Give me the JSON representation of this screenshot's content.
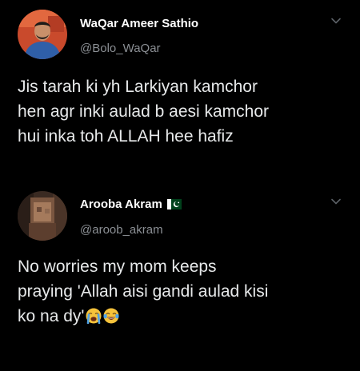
{
  "tweets": [
    {
      "display_name": "WaQar Ameer Sathio",
      "handle": "@Bolo_WaQar",
      "text": "Jis tarah ki yh Larkiyan kamchor\nhen agr inki aulad b aesi kamchor\nhui inka toh ALLAH hee hafiz",
      "menu_icon": "chevron-down-icon",
      "avatar_icon": "avatar"
    },
    {
      "display_name": "Arooba Akram",
      "flag_icon": "pakistan-flag-icon",
      "handle": "@aroob_akram",
      "text": "No worries my mom keeps\npraying 'Allah aisi gandi aulad kisi\nko na dy'",
      "emojis": [
        "loudly-crying-face-icon",
        "face-with-tears-of-joy-icon"
      ],
      "menu_icon": "chevron-down-icon",
      "avatar_icon": "avatar"
    }
  ],
  "colors": {
    "background": "#000000",
    "name": "#ffffff",
    "handle": "#8b8f94",
    "text": "#e7e9ea"
  }
}
